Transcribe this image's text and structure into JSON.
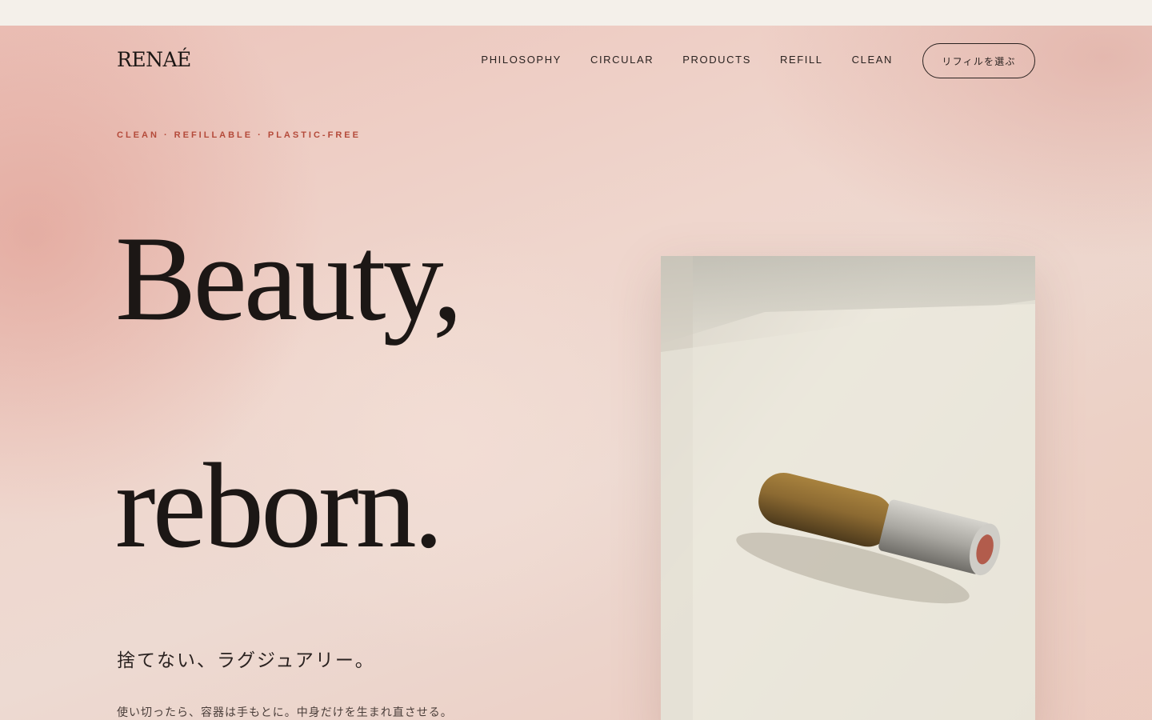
{
  "brand": {
    "logo": "RENAÉ"
  },
  "nav": {
    "items": [
      {
        "label": "PHILOSOPHY"
      },
      {
        "label": "CIRCULAR"
      },
      {
        "label": "PRODUCTS"
      },
      {
        "label": "REFILL"
      },
      {
        "label": "CLEAN"
      }
    ],
    "cta_label": "リフィルを選ぶ"
  },
  "hero": {
    "tagline": "CLEAN · REFILLABLE · PLASTIC-FREE",
    "headline_line1": "Beauty,",
    "headline_line2": "reborn.",
    "subhead": "捨てない、ラグジュアリー。",
    "body": "使い切ったら、容器は手もとに。中身だけを生まれ直させる。"
  },
  "colors": {
    "accent": "#b44a3a",
    "text": "#1c1715",
    "background_pink": "#ecc4bb",
    "background_top": "#f4f0ea"
  }
}
